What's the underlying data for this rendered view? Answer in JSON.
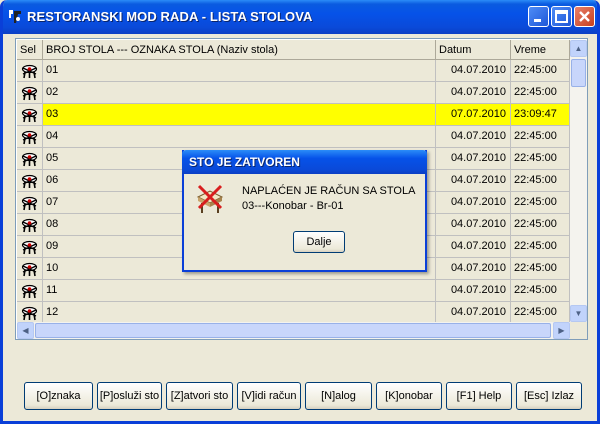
{
  "window": {
    "title": "RESTORANSKI MOD RADA - LISTA STOLOVA"
  },
  "grid": {
    "headers": {
      "sel": "Sel",
      "name": "BROJ STOLA --- OZNAKA STOLA (Naziv stola)",
      "date": "Datum",
      "time": "Vreme"
    },
    "rows": [
      {
        "name": "01",
        "date": "04.07.2010",
        "time": "22:45:00",
        "selected": false
      },
      {
        "name": "02",
        "date": "04.07.2010",
        "time": "22:45:00",
        "selected": false
      },
      {
        "name": "03",
        "date": "07.07.2010",
        "time": "23:09:47",
        "selected": true
      },
      {
        "name": "04",
        "date": "04.07.2010",
        "time": "22:45:00",
        "selected": false
      },
      {
        "name": "05",
        "date": "04.07.2010",
        "time": "22:45:00",
        "selected": false
      },
      {
        "name": "06",
        "date": "04.07.2010",
        "time": "22:45:00",
        "selected": false
      },
      {
        "name": "07",
        "date": "04.07.2010",
        "time": "22:45:00",
        "selected": false
      },
      {
        "name": "08",
        "date": "04.07.2010",
        "time": "22:45:00",
        "selected": false
      },
      {
        "name": "09",
        "date": "04.07.2010",
        "time": "22:45:00",
        "selected": false
      },
      {
        "name": "10",
        "date": "04.07.2010",
        "time": "22:45:00",
        "selected": false
      },
      {
        "name": "11",
        "date": "04.07.2010",
        "time": "22:45:00",
        "selected": false
      },
      {
        "name": "12",
        "date": "04.07.2010",
        "time": "22:45:00",
        "selected": false
      }
    ],
    "selected_row_color": "#ffff00"
  },
  "dialog": {
    "title": "STO JE ZATVOREN",
    "line1": "NAPLAĆEN JE RAČUN SA STOLA",
    "line2": "03---Konobar - Br-01",
    "button": "Dalje"
  },
  "toolbar": {
    "oznaka": "[O]znaka",
    "posluzi": "[P]osluži sto",
    "zatvori": "[Z]atvori sto",
    "vidi": "[V]idi račun",
    "nalog": "[N]alog",
    "konobar": "[K]onobar",
    "help": "[F1] Help",
    "izlaz": "[Esc] Izlaz"
  },
  "icons": {
    "app": "cook-icon",
    "table_row": "table-setting-icon",
    "dialog": "closed-table-icon",
    "minimize": "minimize-icon",
    "maximize": "maximize-icon",
    "close": "close-icon"
  },
  "colors": {
    "titlebar": "#0652e8",
    "window_bg": "#ece9d8",
    "close_btn": "#c8401e"
  }
}
